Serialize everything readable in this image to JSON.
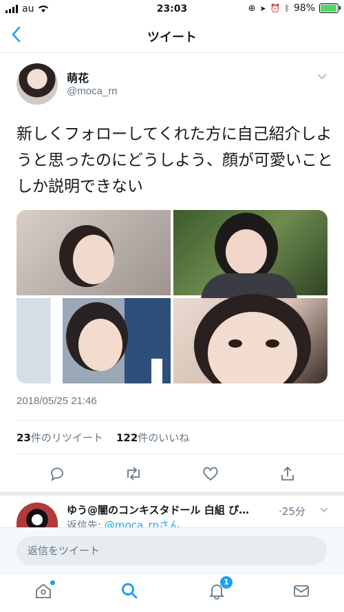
{
  "status_bar": {
    "carrier": "au",
    "time": "23:03",
    "battery": "98%",
    "battery_level": 0.98
  },
  "nav": {
    "title": "ツイート"
  },
  "tweet": {
    "display_name": "萌花",
    "handle": "@moca_rn",
    "text": "新しくフォローしてくれた方に自己紹介しようと思ったのにどうしよう、顔が可愛いことしか説明できない",
    "timestamp": "2018/05/25 21:46",
    "retweet_count": "23",
    "retweet_label": "件のリツイート",
    "like_count": "122",
    "like_label": "件のいいね"
  },
  "reply": {
    "display_name": "ゆう@闇のコンキスタドール 白組 ぴ…",
    "time": "·25分",
    "reply_to_label": "返信先: ",
    "reply_to_link": "@moca_rnさん"
  },
  "composer": {
    "placeholder": "返信をツイート"
  },
  "tabbar": {
    "notification_badge": "1"
  },
  "colors": {
    "accent": "#1da1f2",
    "secondary_text": "#657786",
    "divider": "#e1e8ed"
  }
}
